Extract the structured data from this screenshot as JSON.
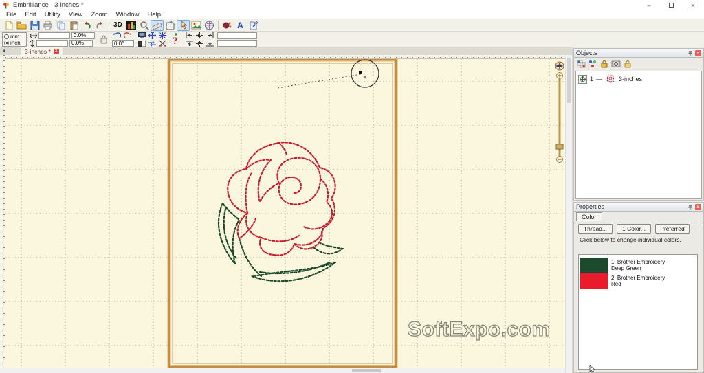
{
  "window": {
    "title": "Embrilliance - 3-inches *",
    "controls": {
      "minimize": "–",
      "close": "×"
    }
  },
  "menu": {
    "items": [
      "File",
      "Edit",
      "Utility",
      "View",
      "Zoom",
      "Window",
      "Help"
    ]
  },
  "toolbar1": {
    "labels": {
      "view3d": "3D",
      "lettering": "A"
    }
  },
  "toolbar2": {
    "units": {
      "mm": "mm",
      "inch": "inch",
      "selected": "inch"
    },
    "fields": {
      "width_value": "",
      "width_pct": "0.0%",
      "height_value": "",
      "height_pct": "0.0%",
      "angle": "0.0°",
      "extra_top": "",
      "extra_bottom": ""
    }
  },
  "tabbar": {
    "tab_label": "3-inches *",
    "close": "×"
  },
  "canvas": {
    "watermark": "SoftExpo.com"
  },
  "objects_panel": {
    "title": "Objects",
    "close": "×",
    "item": {
      "num": "1",
      "sep": "—",
      "label": "3-inches"
    }
  },
  "properties_panel": {
    "title": "Properties",
    "close": "×",
    "tab": "Color",
    "buttons": {
      "thread": "Thread...",
      "one_color": "1 Color...",
      "preferred": "Preferred"
    },
    "hint": "Click below to change individual colors.",
    "colors": [
      {
        "line1": "1: Brother Embroidery",
        "line2": "Deep Green",
        "hex": "#1b4a2c"
      },
      {
        "line1": "2: Brother Embroidery",
        "line2": "Red",
        "hex": "#e81c2a"
      }
    ]
  },
  "design": {
    "hoop_color": "#d29f56",
    "stitch_red": "#c21f30",
    "stitch_green": "#1d4a2b",
    "canvas_color": "#fbf7de"
  },
  "icons": {
    "app-icon": "flower-logo",
    "new-icon": "blank-page",
    "open-icon": "folder",
    "save-icon": "floppy-disk",
    "print-icon": "printer",
    "copy-icon": "pages",
    "paste-icon": "clipboard",
    "undo-icon": "curved-arrow-left",
    "redo-icon": "curved-arrow-right",
    "stitch-view-icon": "bar-chart",
    "zoom-icon": "magnifier",
    "measure-icon": "ruler",
    "hoop-icon": "embroidery-hoop",
    "pointer-icon": "hand-pointer",
    "background-image-icon": "photo",
    "mesh-icon": "net-sphere",
    "library-icon": "sphere-dots",
    "merge-icon": "page-needle",
    "lock-icon": "padlock",
    "rotate-left-icon": "curved-arrow-ccw",
    "rotate-right-icon": "curved-arrow-cw",
    "monitor-icon": "monitor",
    "center-hoop-icon": "cross-arrows",
    "snap-icon": "snowflake",
    "contrast-icon": "half-square",
    "mirror-icon": "swap-arrows",
    "trim-icon": "scissors",
    "sew-simulate-icon": "red-question",
    "align-icons": "align-grid",
    "group-icon": "object-dots",
    "ungroup-icon": "object-dots-plus",
    "camera-icon": "camera",
    "pin-icon": "pushpin",
    "move-icon": "four-way-arrow",
    "compass-icon": "compass-rose",
    "zoom-plus-icon": "plus-circle",
    "zoom-minus-icon": "minus-circle"
  }
}
